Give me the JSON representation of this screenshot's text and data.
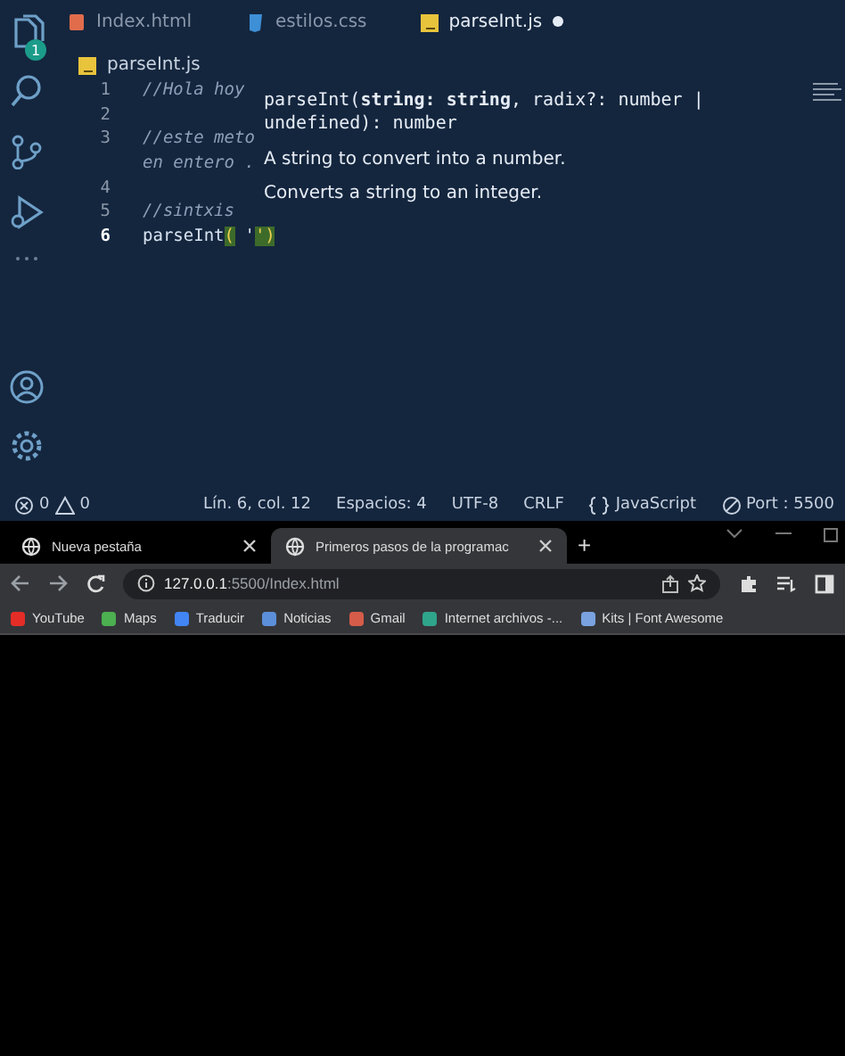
{
  "editor": {
    "source_control_badge": "1",
    "tabs": [
      {
        "label": "Index.html",
        "kind": "html",
        "selected": false,
        "dirty": false
      },
      {
        "label": "estilos.css",
        "kind": "css",
        "selected": false,
        "dirty": false
      },
      {
        "label": "parseInt.js",
        "kind": "js",
        "selected": true,
        "dirty": true
      }
    ],
    "breadcrumb": "parseInt.js",
    "lines": [
      {
        "number": "1",
        "current": false,
        "tokens": [
          {
            "text": "//Hola hoy",
            "kind": "comment"
          }
        ]
      },
      {
        "number": "2",
        "current": false
      },
      {
        "number": "3",
        "current": false,
        "tokens": [
          {
            "text": "//este meto",
            "kind": "comment"
          }
        ]
      },
      {
        "tokens": [
          {
            "text": "en entero .",
            "kind": "comment"
          }
        ]
      },
      {
        "number": "4",
        "current": false
      },
      {
        "number": "5",
        "current": false,
        "tokens": [
          {
            "text": "//sintxis",
            "kind": "comment"
          }
        ]
      },
      {
        "number": "6",
        "current": true,
        "tokens": [
          {
            "text": "parseInt",
            "kind": "function"
          },
          {
            "text": "(",
            "kind": "bracket"
          },
          {
            "text": " '",
            "kind": "string"
          },
          {
            "text": "')",
            "kind": "bracket"
          }
        ]
      }
    ],
    "hover": {
      "signature": "parseInt(**string: string**, radix?: number | undefined): number",
      "docs": [
        "A string to convert into a number.",
        "Converts a string to an integer."
      ]
    },
    "status": {
      "errors": "0",
      "warnings": "0",
      "items": [
        {
          "text": "Lín. 6, col. 12",
          "kind": "plain"
        },
        {
          "text": "Espacios: 4",
          "kind": "plain"
        },
        {
          "text": "UTF-8",
          "kind": "plain"
        },
        {
          "text": "CRLF",
          "kind": "plain"
        },
        {
          "text": "JavaScript",
          "kind": "language"
        },
        {
          "text": "Port : 5500",
          "kind": "port"
        }
      ]
    }
  },
  "browser": {
    "tabs": [
      {
        "title": "Nueva pestaña",
        "selected": false
      },
      {
        "title": "Primeros pasos de la programac",
        "selected": true
      }
    ],
    "new_tab": "+",
    "url": {
      "host": "127.0.0.1",
      "path": ":5500/Index.html"
    },
    "bookmarks": [
      {
        "label": "YouTube",
        "color": "#e52d27"
      },
      {
        "label": "Maps",
        "color": "#4caf50"
      },
      {
        "label": "Traducir",
        "color": "#4285f4"
      },
      {
        "label": "Noticias",
        "color": "#5b8fd9"
      },
      {
        "label": "Gmail",
        "color": "#d65c4a"
      },
      {
        "label": "Internet archivos -...",
        "color": "#2fa58c"
      },
      {
        "label": "Kits | Font Awesome",
        "color": "#7aa2e0"
      }
    ]
  }
}
